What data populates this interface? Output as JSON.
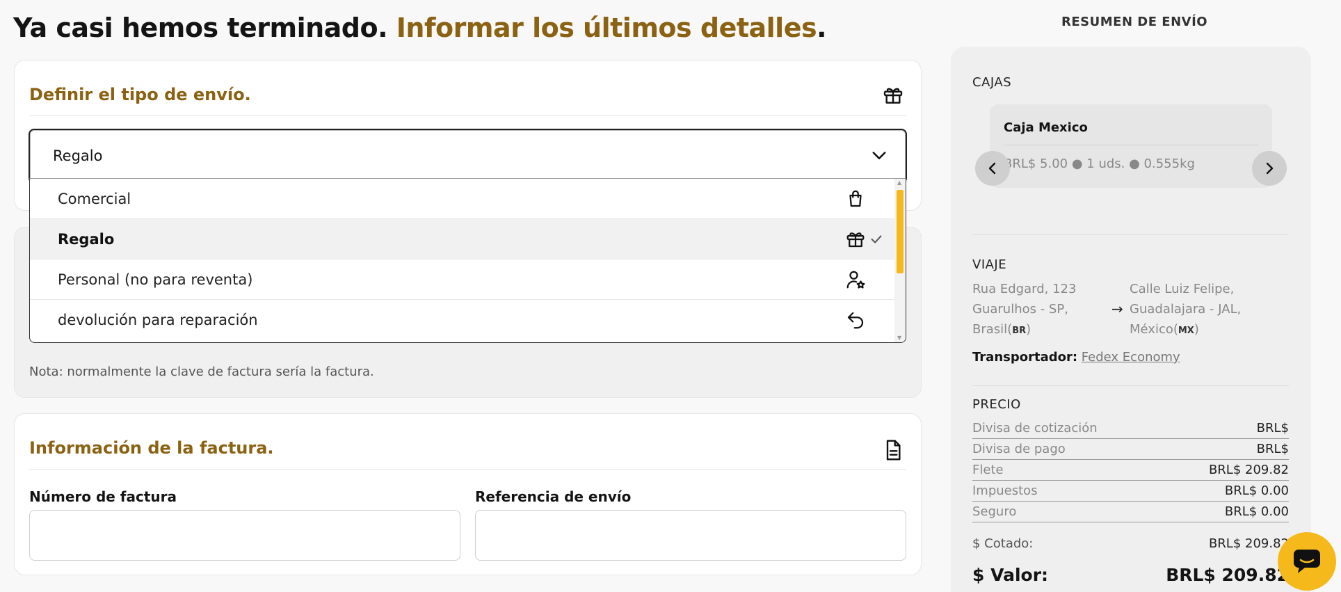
{
  "header": {
    "title_part1": "Ya casi hemos terminado.",
    "title_part2": "Informar los últimos detalles",
    "title_period": "."
  },
  "shipping_type": {
    "title": "Definir el tipo de envío.",
    "selected_value": "Regalo",
    "options": [
      {
        "label": "Comercial",
        "icon": "shopping-bag-icon"
      },
      {
        "label": "Regalo",
        "icon": "gift-icon",
        "selected": true
      },
      {
        "label": "Personal (no para reventa)",
        "icon": "user-star-icon"
      },
      {
        "label": "devolución para reparación",
        "icon": "return-arrow-icon"
      }
    ]
  },
  "note": "Nota: normalmente la clave de factura sería la factura.",
  "invoice": {
    "title": "Información de la factura.",
    "number_label": "Número de factura",
    "reference_label": "Referencia de envío",
    "number_value": "",
    "reference_value": ""
  },
  "summary": {
    "heading": "RESUMEN DE ENVÍO",
    "boxes_title": "CAJAS",
    "box": {
      "name": "Caja Mexico",
      "details": "BRL$ 5.00 ● 1 uds. ● 0.555kg"
    },
    "trip_title": "VIAJE",
    "origin": {
      "line1": "Rua Edgard, 123",
      "line2": "Guarulhos - SP,",
      "line3": "Brasil(",
      "country_code": "BR",
      "line3_end": ")"
    },
    "destination": {
      "line1": "Calle Luiz Felipe,",
      "line2": "Guadalajara - JAL,",
      "line3": "México(",
      "country_code": "MX",
      "line3_end": ")"
    },
    "arrow": "→",
    "carrier_label": "Transportador:",
    "carrier_value": "Fedex Economy",
    "price_title": "PRECIO",
    "price_rows": [
      {
        "label": "Divisa de cotización",
        "value": "BRL$"
      },
      {
        "label": "Divisa de pago",
        "value": "BRL$"
      },
      {
        "label": "Flete",
        "value": "BRL$ 209.82"
      },
      {
        "label": "Impuestos",
        "value": "BRL$ 0.00"
      },
      {
        "label": "Seguro",
        "value": "BRL$ 0.00"
      }
    ],
    "quoted_label": "$ Cotado:",
    "quoted_value": "BRL$ 209.82",
    "total_label": "$ Valor:",
    "total_value": "BRL$ 209.82"
  },
  "colors": {
    "accent_gold": "#8b6112",
    "scroll_thumb": "#f6b91c",
    "chat_button": "#f6b91c"
  }
}
